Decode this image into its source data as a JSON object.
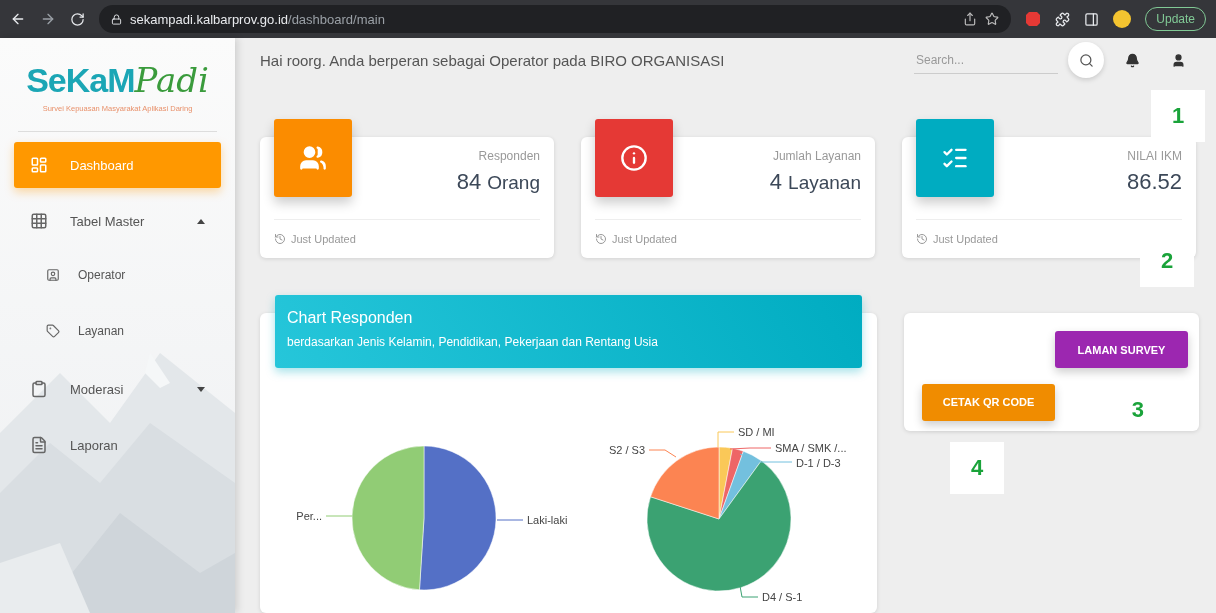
{
  "browser": {
    "url_host": "sekampadi.kalbarprov.go.id",
    "url_path": "/dashboard/main",
    "update_button": "Update"
  },
  "sidebar": {
    "logo": {
      "primary": "SeKaM",
      "script": "Padi",
      "tagline": "Survei Kepuasan Masyarakat Aplikasi Daring"
    },
    "items": [
      {
        "label": "Dashboard",
        "kind": "dashboard",
        "selected": true
      },
      {
        "label": "Tabel Master",
        "kind": "table",
        "selected": false,
        "expanded": true,
        "children": [
          {
            "label": "Operator",
            "kind": "person",
            "selected": false
          },
          {
            "label": "Layanan",
            "kind": "tag",
            "selected": false
          }
        ]
      },
      {
        "label": "Moderasi",
        "kind": "clipboard",
        "selected": false,
        "expanded": false
      },
      {
        "label": "Laporan",
        "kind": "file",
        "selected": false
      }
    ]
  },
  "header": {
    "greeting": "Hai roorg. Anda berperan sebagai Operator pada BIRO ORGANISASI",
    "search": {
      "placeholder": "Search..."
    }
  },
  "stats": [
    {
      "title": "Responden",
      "value": "84",
      "unit": "Orang",
      "footer": "Just Updated",
      "kind": "people",
      "color": "#fb8c00"
    },
    {
      "title": "Jumlah Layanan",
      "value": "4",
      "unit": "Layanan",
      "footer": "Just Updated",
      "kind": "info",
      "color": "#e53935"
    },
    {
      "title": "NILAI IKM",
      "value": "86.52",
      "footer": "Just Updated",
      "kind": "checklist",
      "color": "#00acc1"
    }
  ],
  "chart_card": {
    "title": "Chart Responden",
    "subtitle": "berdasarkan Jenis Kelamin, Pendidikan, Pekerjaan dan Rentang Usia",
    "pies": [
      {
        "labels": [
          {
            "text": "Laki-laki",
            "color": "#5470c6"
          },
          {
            "text": "Per...",
            "color": "#91cc75"
          }
        ]
      },
      {
        "labels": [
          {
            "text": "SD / MI",
            "color": "#fac858"
          },
          {
            "text": "SMA / SMK /...",
            "color": "#ee6666"
          },
          {
            "text": "D-1 / D-3",
            "color": "#73c0de"
          },
          {
            "text": "D4 / S-1",
            "color": "#3ba272"
          },
          {
            "text": "S2 / S3",
            "color": "#fc8452"
          }
        ]
      }
    ]
  },
  "actions": [
    {
      "label": "LAMAN SURVEY",
      "kind": "survey"
    },
    {
      "label": "CETAK QR CODE",
      "kind": "qr"
    }
  ],
  "annotations": [
    "1",
    "2",
    "3",
    "4"
  ]
}
